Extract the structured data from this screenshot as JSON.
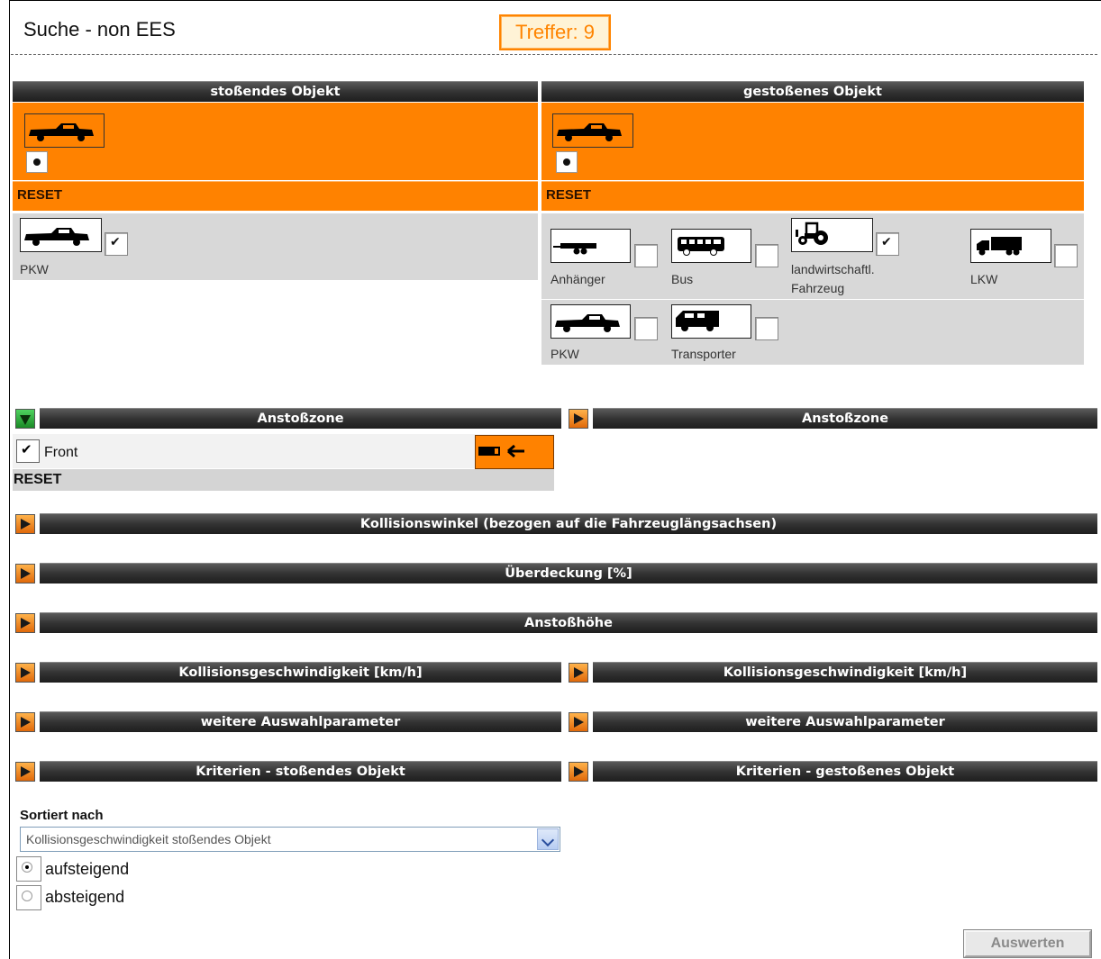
{
  "header": {
    "title": "Suche - non EES",
    "hits": "Treffer: 9"
  },
  "left": {
    "header": "stoßendes Objekt",
    "reset": "RESET",
    "vehicles": [
      {
        "label": "PKW",
        "checked": true
      }
    ]
  },
  "right": {
    "header": "gestoßenes Objekt",
    "reset": "RESET",
    "vehicles": [
      {
        "label": "Anhänger",
        "checked": false
      },
      {
        "label": "Bus",
        "checked": false
      },
      {
        "label": "landwirtschaftl. Fahrzeug",
        "checked": true
      },
      {
        "label": "LKW",
        "checked": false
      },
      {
        "label": "PKW",
        "checked": false
      },
      {
        "label": "Transporter",
        "checked": false
      }
    ]
  },
  "sections": {
    "anstoss_left": "Anstoßzone",
    "anstoss_right": "Anstoßzone",
    "front": "Front",
    "front_reset": "RESET",
    "winkel": "Kollisionswinkel (bezogen auf die Fahrzeuglängsachsen)",
    "ueberdeckung": "Überdeckung [%]",
    "anstosshoehe": "Anstoßhöhe",
    "geschw_left": "Kollisionsgeschwindigkeit [km/h]",
    "geschw_right": "Kollisionsgeschwindigkeit [km/h]",
    "weitere_left": "weitere Auswahlparameter",
    "weitere_right": "weitere Auswahlparameter",
    "kriterien_left": "Kriterien - stoßendes Objekt",
    "kriterien_right": "Kriterien - gestoßenes Objekt"
  },
  "sort": {
    "label": "Sortiert nach",
    "selected": "Kollisionsgeschwindigkeit stoßendes Objekt",
    "asc": "aufsteigend",
    "desc": "absteigend",
    "asc_selected": true
  },
  "button": {
    "evaluate": "Auswerten"
  },
  "colors": {
    "accent": "#ff8200",
    "bar": "#333333"
  }
}
